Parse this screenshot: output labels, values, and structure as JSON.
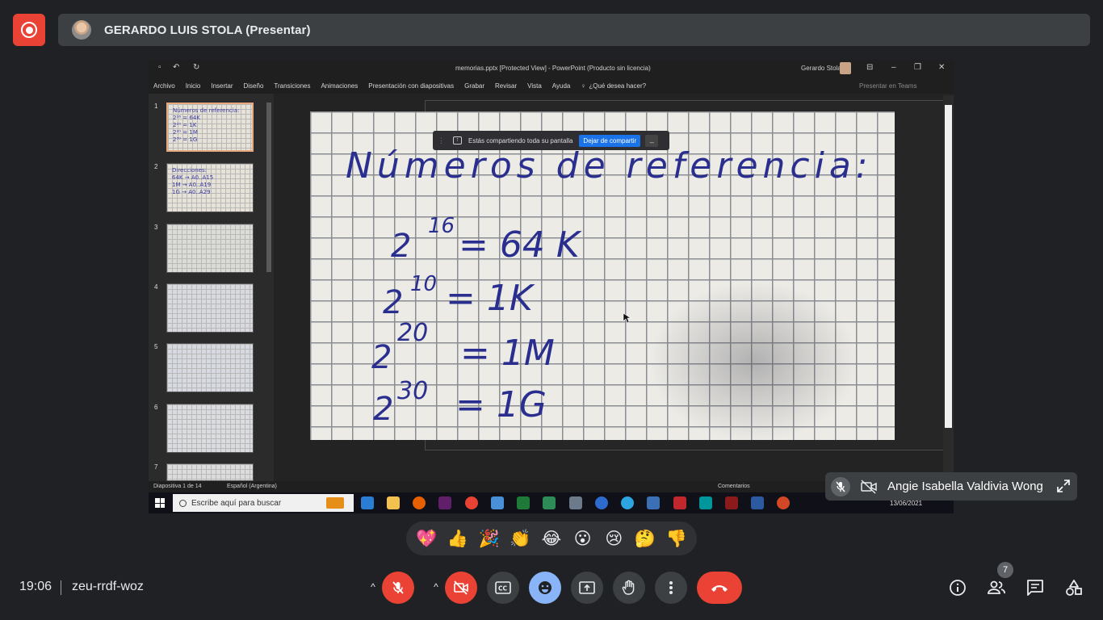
{
  "header": {
    "record_icon": "record-icon",
    "presenter_name": "GERARDO LUIS STOLA (Presentar)"
  },
  "shared_screen": {
    "window_title": "memorias.pptx [Protected View]  -  PowerPoint (Producto sin licencia)",
    "user_name": "Gerardo Stola",
    "menu": [
      "Archivo",
      "Inicio",
      "Insertar",
      "Diseño",
      "Transiciones",
      "Animaciones",
      "Presentación con diapositivas",
      "Grabar",
      "Revisar",
      "Vista",
      "Ayuda",
      "¿Qué desea hacer?"
    ],
    "menu_right": "Presentar en Teams",
    "share_notice": {
      "message": "Estás compartiendo toda su pantalla",
      "stop_button": "Dejar de compartir",
      "hide_button": "_"
    },
    "thumbnails": [
      {
        "num": "1",
        "text": "Números de referencia:\n2¹⁶ = 64K\n2¹⁰ = 1K\n2²⁰ = 1M\n2³⁰ = 1G"
      },
      {
        "num": "2",
        "text": "Direcciones:\n64K → A0..A15\n1M → A0..A19\n1G → A0..A29"
      },
      {
        "num": "3",
        "text": ""
      },
      {
        "num": "4",
        "text": ""
      },
      {
        "num": "5",
        "text": ""
      },
      {
        "num": "6",
        "text": ""
      },
      {
        "num": "7",
        "text": ""
      }
    ],
    "slide": {
      "title": "Números de referencia:",
      "lines": [
        {
          "base": "2",
          "exp": "16",
          "value": "= 64 K"
        },
        {
          "base": "2",
          "exp": "10",
          "value": "= 1K"
        },
        {
          "base": "2",
          "exp": "20",
          "value": "= 1M"
        },
        {
          "base": "2",
          "exp": "30",
          "value": "= 1G"
        }
      ]
    },
    "status": {
      "slide_count": "Diapositiva 1 de 14",
      "language": "Español (Argentina)",
      "comments": "Comentarios"
    },
    "taskbar": {
      "search_placeholder": "Escribe aquí para buscar",
      "date": "13/06/2021"
    }
  },
  "participant": {
    "name": "Angie Isabella Valdivia Wong"
  },
  "reactions": [
    "💖",
    "👍",
    "🎉",
    "👏",
    "😂",
    "😮",
    "😢",
    "🤔",
    "👎"
  ],
  "footer": {
    "time": "19:06",
    "meeting_code": "zeu-rrdf-woz",
    "people_count": "7"
  },
  "colors": {
    "background": "#202124",
    "danger": "#ea4335",
    "accent": "#8ab4f8",
    "surface": "#3c4043"
  }
}
